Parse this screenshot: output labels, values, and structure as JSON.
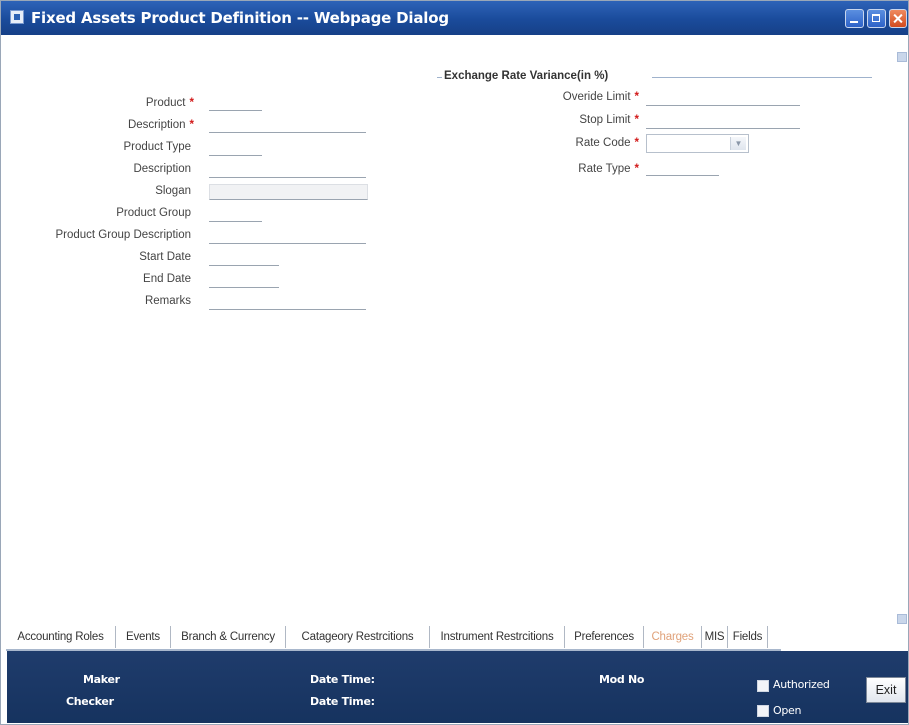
{
  "window": {
    "title": "Fixed Assets Product Definition -- Webpage Dialog"
  },
  "form": {
    "left_fields": [
      {
        "label": "Product",
        "required": true
      },
      {
        "label": "Description",
        "required": true
      },
      {
        "label": "Product Type",
        "required": false
      },
      {
        "label": "Description",
        "required": false
      },
      {
        "label": "Slogan",
        "required": false
      },
      {
        "label": "Product Group",
        "required": false
      },
      {
        "label": "Product Group Description",
        "required": false
      },
      {
        "label": "Start Date",
        "required": false
      },
      {
        "label": "End Date",
        "required": false
      },
      {
        "label": "Remarks",
        "required": false
      }
    ],
    "required_marker": "*",
    "exchange": {
      "legend": "Exchange Rate Variance(in %)",
      "overide_limit": "Overide Limit",
      "stop_limit": "Stop Limit",
      "rate_code": "Rate Code",
      "rate_code_value": "",
      "rate_type": "Rate Type"
    }
  },
  "tabs": [
    "Accounting Roles",
    "Events",
    "Branch & Currency",
    "Catageory Restrcitions",
    "Instrument Restrcitions",
    "Preferences",
    "Charges",
    "MIS",
    "Fields"
  ],
  "footer": {
    "maker": "Maker",
    "checker": "Checker",
    "date_time_1": "Date Time:",
    "date_time_2": "Date Time:",
    "mod_no": "Mod No",
    "authorized": "Authorized",
    "open": "Open",
    "exit": "Exit"
  }
}
